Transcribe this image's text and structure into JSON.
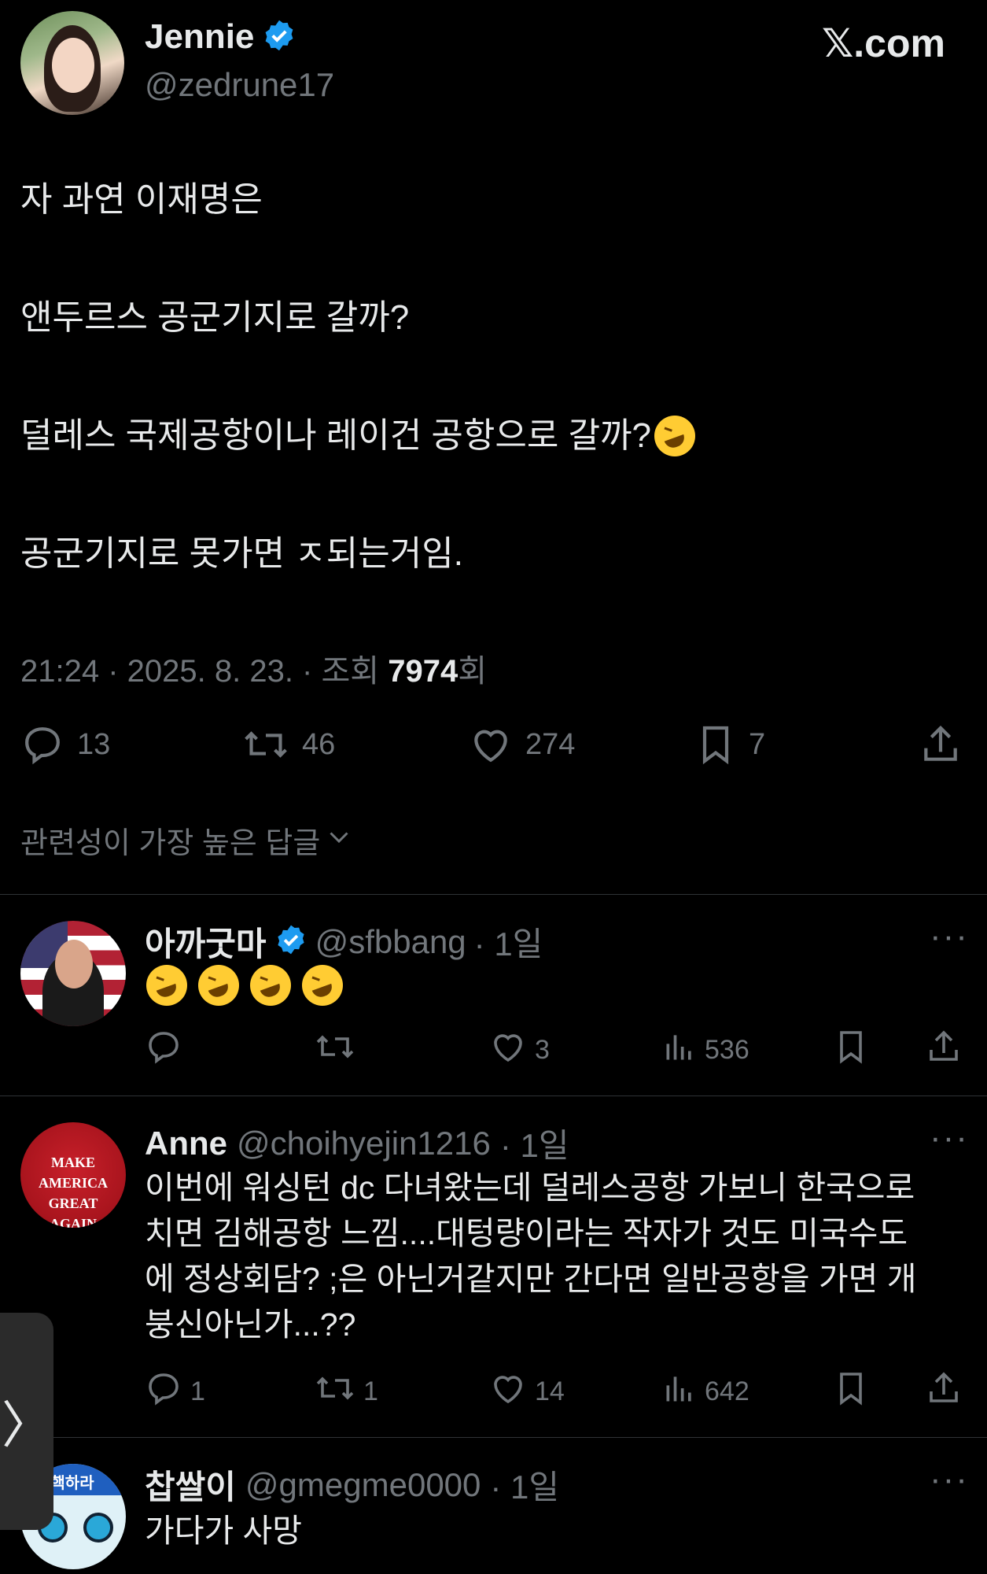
{
  "brand": {
    "logo_text": "𝕏.com"
  },
  "post": {
    "author_name": "Jennie",
    "author_handle": "@zedrune17",
    "lines": [
      "자 과연 이재명은",
      "앤두르스 공군기지로 갈까?",
      "덜레스 국제공항이나 레이건 공항으로 갈까?",
      "공군기지로 못가면 ㅈ되는거임."
    ],
    "meta_time": "21:24 · 2025. 8. 23. · 조회 ",
    "meta_views": "7974",
    "meta_suffix": "회",
    "stats": {
      "replies": "13",
      "reposts": "46",
      "likes": "274",
      "bookmarks": "7"
    }
  },
  "sort_label": "관련성이 가장 높은 답글",
  "replies": [
    {
      "name": "아까굿마",
      "handle": "@sfbbang",
      "age": "· 1일",
      "text": "",
      "replies": "",
      "reposts": "",
      "likes": "3",
      "views": "536"
    },
    {
      "name": "Anne",
      "handle": "@choihyejin1216",
      "age": "· 1일",
      "text_lines": [
        "이번에 워싱턴 dc 다녀왔는데 덜레스공항 가보니 한국으로",
        "치면 김해공항 느낌....대텅량이라는 작자가 것도 미국수도",
        "에 정상회담? ;은 아닌거같지만 간다면 일반공항을 가면 개",
        "붕신아닌가...??"
      ],
      "replies": "1",
      "reposts": "1",
      "likes": "14",
      "views": "642",
      "avatar_text": "MAKE AMERICA GREAT AGAIN"
    },
    {
      "name": "찹쌀이",
      "handle": "@gmegme0000",
      "age": "· 1일",
      "text": "가다가 사망",
      "avatar_text": "탄핵하라"
    }
  ],
  "side_tab": {
    "label": "〉"
  },
  "colors": {
    "verified": "#1d9bf0",
    "muted": "#71767b",
    "text": "#e7e9ea"
  }
}
